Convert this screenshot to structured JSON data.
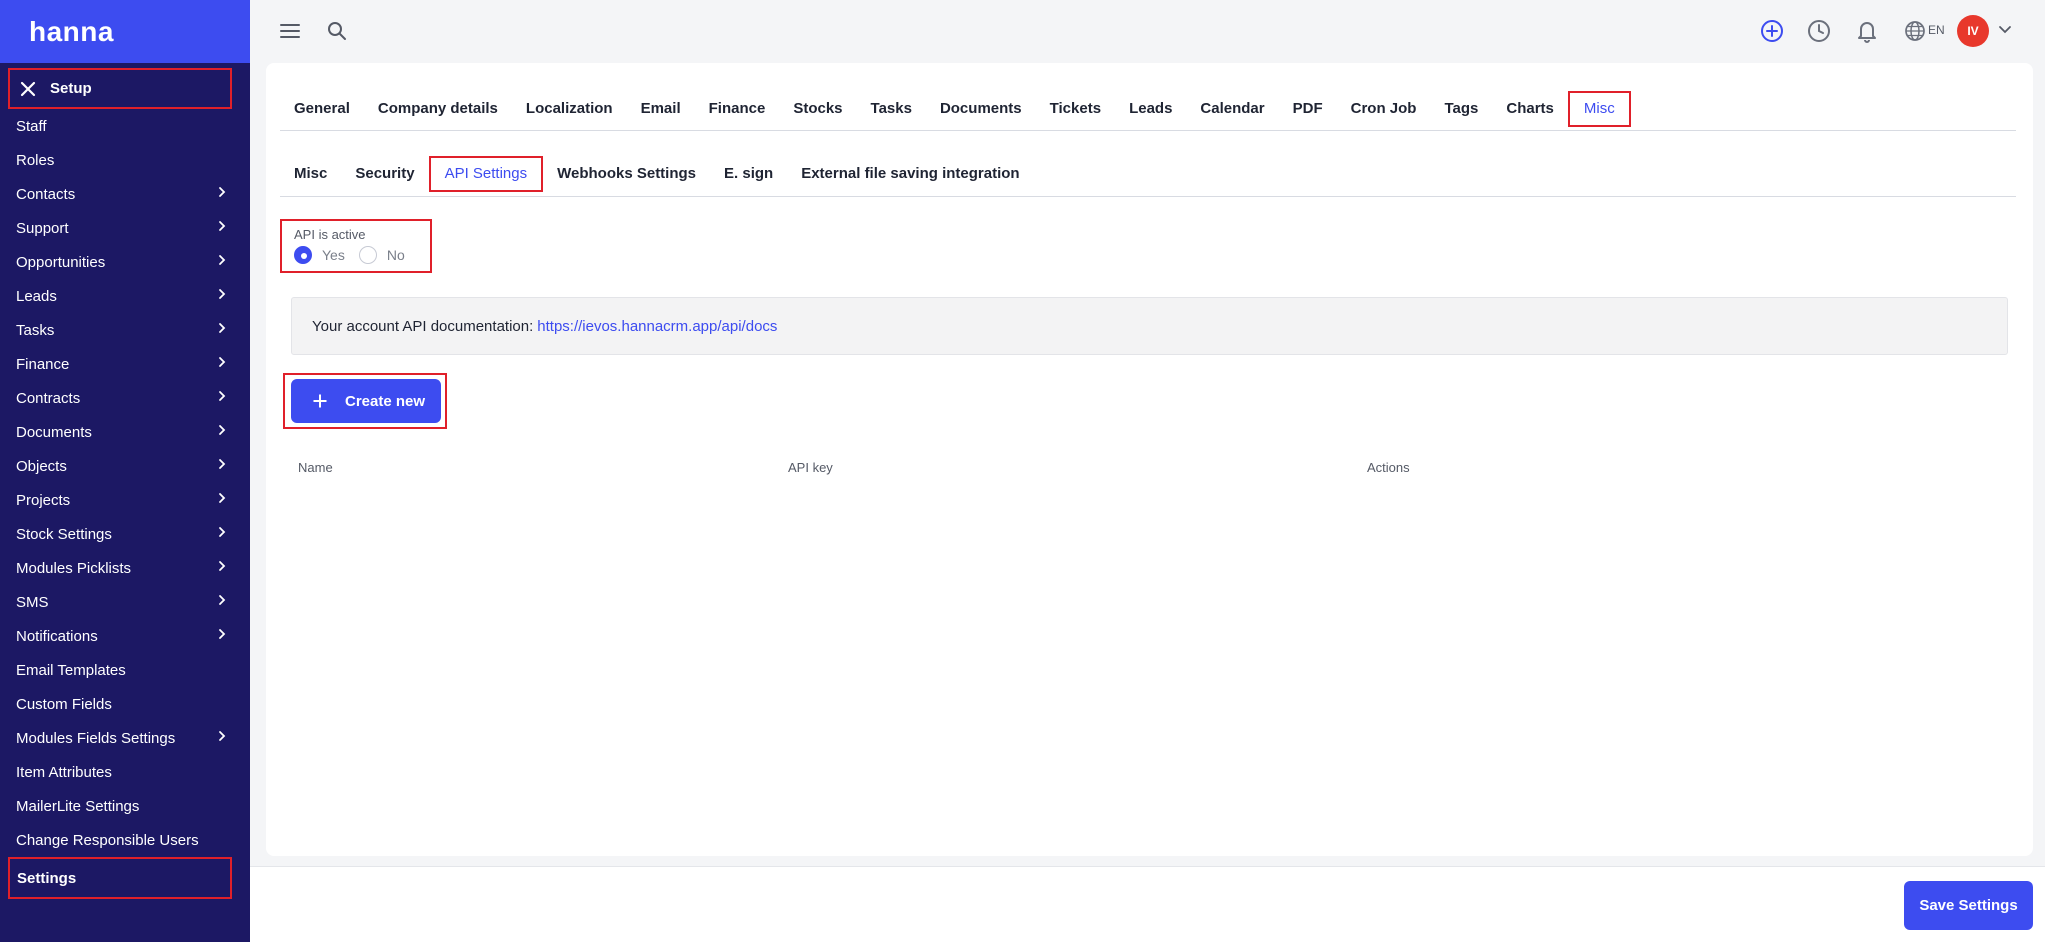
{
  "brand": {
    "logo_text": "hanna",
    "accent": "#3d4cf0",
    "sidebar_bg": "#1c1864",
    "highlight": "#e0202a"
  },
  "sidebar": {
    "setup_label": "Setup",
    "items": [
      {
        "label": "Staff",
        "has_children": false
      },
      {
        "label": "Roles",
        "has_children": false
      },
      {
        "label": "Contacts",
        "has_children": true
      },
      {
        "label": "Support",
        "has_children": true
      },
      {
        "label": "Opportunities",
        "has_children": true
      },
      {
        "label": "Leads",
        "has_children": true
      },
      {
        "label": "Tasks",
        "has_children": true
      },
      {
        "label": "Finance",
        "has_children": true
      },
      {
        "label": "Contracts",
        "has_children": true
      },
      {
        "label": "Documents",
        "has_children": true
      },
      {
        "label": "Objects",
        "has_children": true
      },
      {
        "label": "Projects",
        "has_children": true
      },
      {
        "label": "Stock Settings",
        "has_children": true
      },
      {
        "label": "Modules Picklists",
        "has_children": true
      },
      {
        "label": "SMS",
        "has_children": true
      },
      {
        "label": "Notifications",
        "has_children": true
      },
      {
        "label": "Email Templates",
        "has_children": false
      },
      {
        "label": "Custom Fields",
        "has_children": false
      },
      {
        "label": "Modules Fields Settings",
        "has_children": true
      },
      {
        "label": "Item Attributes",
        "has_children": false
      },
      {
        "label": "MailerLite Settings",
        "has_children": false
      },
      {
        "label": "Change Responsible Users",
        "has_children": false
      },
      {
        "label": "Settings",
        "has_children": false,
        "active": true
      }
    ]
  },
  "topbar": {
    "language": "EN",
    "avatar_initials": "IV",
    "avatar_color": "#e8382c",
    "icons": [
      "menu-icon",
      "search-icon",
      "add-circle-icon",
      "clock-icon",
      "bell-icon",
      "globe-icon",
      "chevron-down-icon"
    ]
  },
  "main_tabs": [
    "General",
    "Company details",
    "Localization",
    "Email",
    "Finance",
    "Stocks",
    "Tasks",
    "Documents",
    "Tickets",
    "Leads",
    "Calendar",
    "PDF",
    "Cron Job",
    "Tags",
    "Charts",
    "Misc"
  ],
  "main_tab_active": "Misc",
  "sub_tabs": [
    "Misc",
    "Security",
    "API Settings",
    "Webhooks Settings",
    "E. sign",
    "External file saving integration"
  ],
  "sub_tab_active": "API Settings",
  "api_active": {
    "label": "API is active",
    "options": [
      "Yes",
      "No"
    ],
    "selected": "Yes"
  },
  "api_docs": {
    "text": "Your account API documentation:",
    "link": "https://ievos.hannacrm.app/api/docs"
  },
  "create_button": "Create new",
  "table": {
    "columns": [
      "Name",
      "API key",
      "Actions"
    ],
    "rows": []
  },
  "save_button": "Save Settings"
}
